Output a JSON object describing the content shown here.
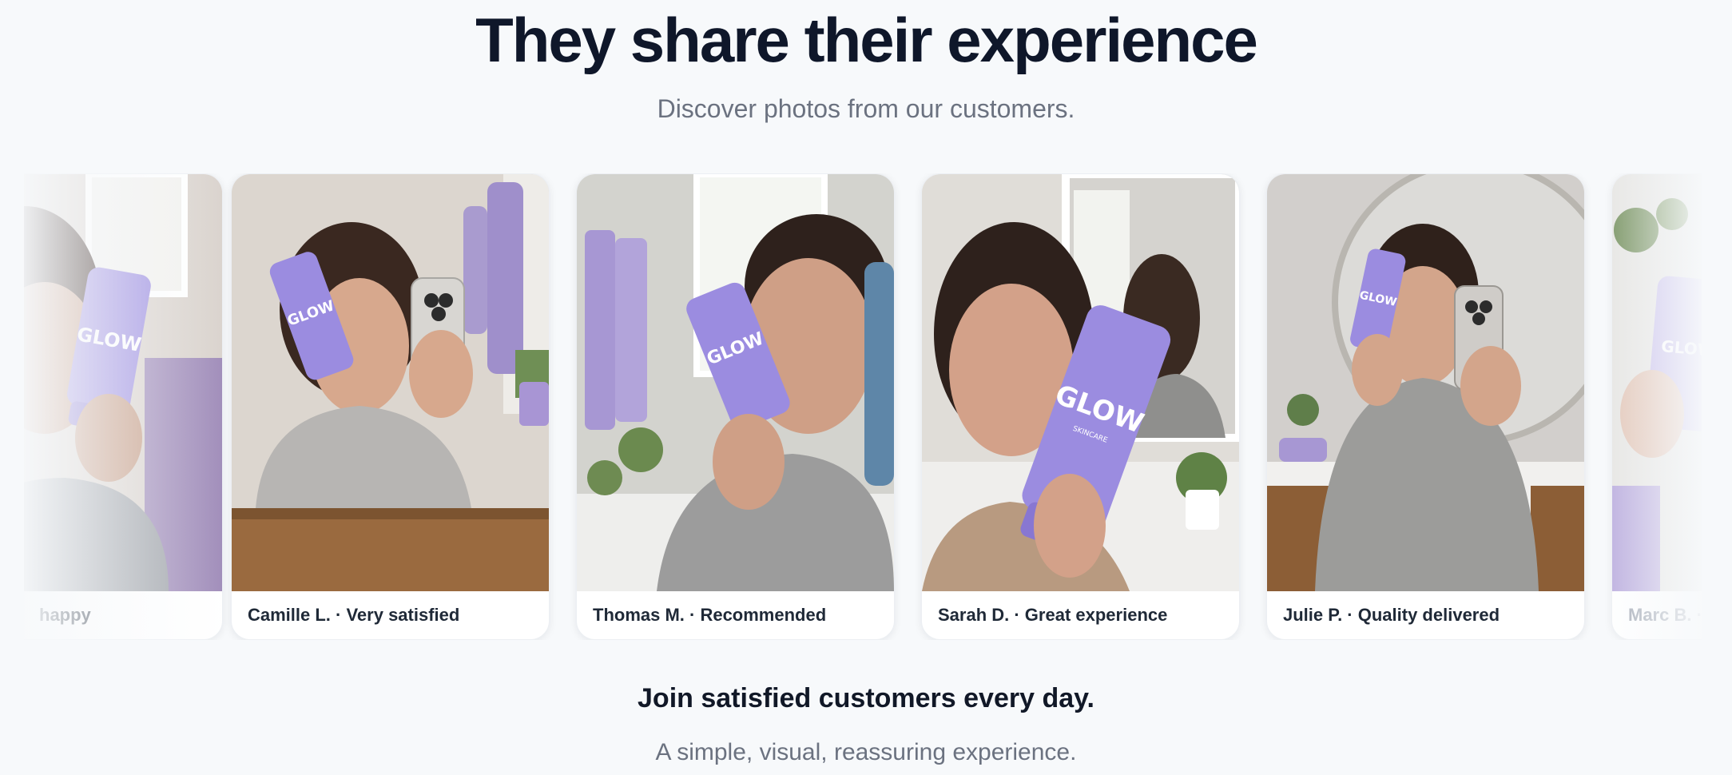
{
  "header": {
    "title": "They share their experience",
    "subtitle": "Discover photos from our customers."
  },
  "product": {
    "brand": "GLOW",
    "tag": "SKINCARE"
  },
  "cards": [
    {
      "caption": "happy"
    },
    {
      "caption": "Camille L. · Very satisfied"
    },
    {
      "caption": "Thomas M. · Recommended"
    },
    {
      "caption": "Sarah D. · Great experience"
    },
    {
      "caption": "Julie P. · Quality delivered"
    },
    {
      "caption": "Marc B. · S"
    }
  ],
  "footer": {
    "headline": "Join satisfied customers every day.",
    "tagline": "A simple, visual, reassuring experience."
  },
  "colors": {
    "background": "#f7f9fb",
    "product_purple": "#9b8ce0",
    "heading": "#0f172a",
    "muted": "#6b7280"
  }
}
